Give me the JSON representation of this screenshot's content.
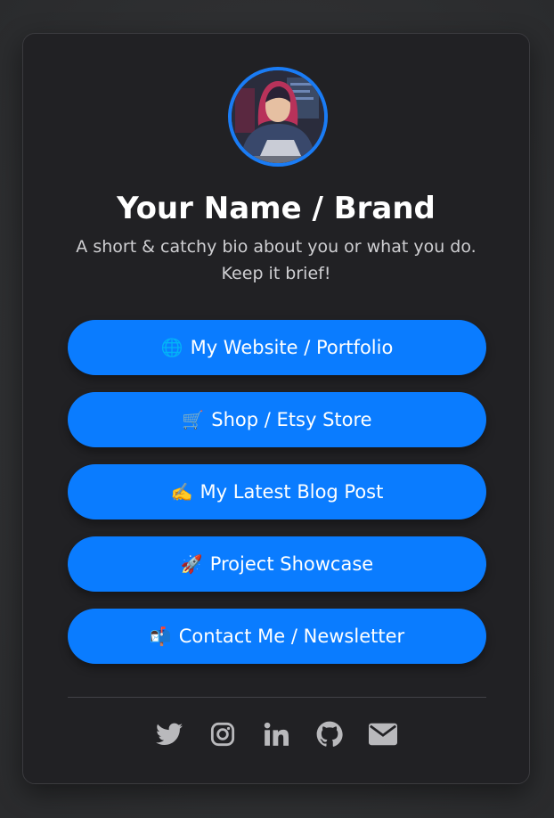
{
  "profile": {
    "name": "Your Name / Brand",
    "bio": "A short & catchy bio about you or what you do. Keep it brief!"
  },
  "links": [
    {
      "emoji": "🌐",
      "label": "My Website / Portfolio"
    },
    {
      "emoji": "🛒",
      "label": "Shop / Etsy Store"
    },
    {
      "emoji": "✍️",
      "label": "My Latest Blog Post"
    },
    {
      "emoji": "🚀",
      "label": "Project Showcase"
    },
    {
      "emoji": "📬",
      "label": "Contact Me / Newsletter"
    }
  ],
  "socials": [
    "twitter-icon",
    "instagram-icon",
    "linkedin-icon",
    "github-icon",
    "email-icon"
  ],
  "colors": {
    "background": "#2f3032",
    "card": "#212124",
    "accent": "#0a7cff",
    "icon": "#b9b9bc"
  }
}
